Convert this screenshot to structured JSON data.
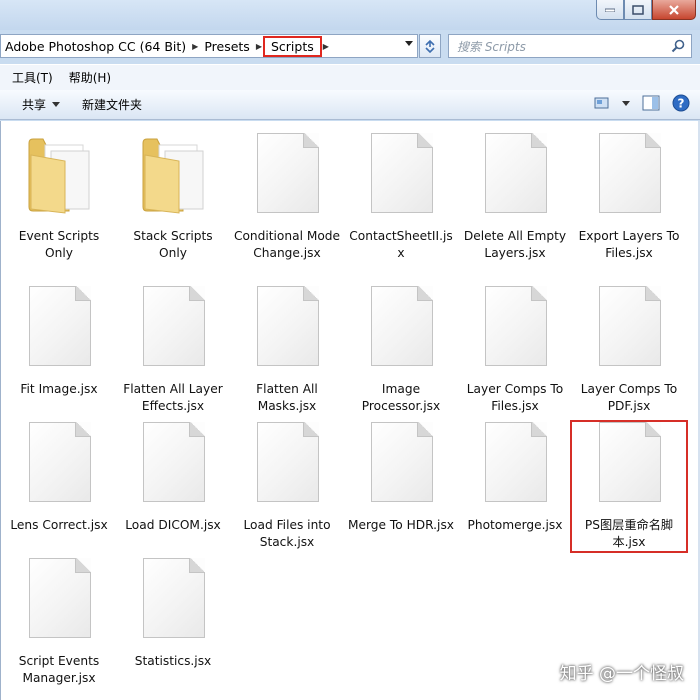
{
  "breadcrumb": [
    "Adobe Photoshop CC (64 Bit)",
    "Presets",
    "Scripts"
  ],
  "search": {
    "placeholder": "搜索 Scripts"
  },
  "menu": [
    "工具(T)",
    "帮助(H)"
  ],
  "toolbar": {
    "share_label": "共享",
    "new_folder_label": "新建文件夹"
  },
  "files": [
    {
      "name": "Event Scripts Only",
      "type": "folder"
    },
    {
      "name": "Stack Scripts Only",
      "type": "folder"
    },
    {
      "name": "Conditional Mode Change.jsx",
      "type": "file"
    },
    {
      "name": "ContactSheetII.jsx",
      "type": "file"
    },
    {
      "name": "Delete All Empty Layers.jsx",
      "type": "file"
    },
    {
      "name": "Export Layers To Files.jsx",
      "type": "file"
    },
    {
      "name": "Fit Image.jsx",
      "type": "file"
    },
    {
      "name": "Flatten All Layer Effects.jsx",
      "type": "file"
    },
    {
      "name": "Flatten All Masks.jsx",
      "type": "file"
    },
    {
      "name": "Image Processor.jsx",
      "type": "file"
    },
    {
      "name": "Layer Comps To Files.jsx",
      "type": "file"
    },
    {
      "name": "Layer Comps To PDF.jsx",
      "type": "file"
    },
    {
      "name": "Lens Correct.jsx",
      "type": "file"
    },
    {
      "name": "Load DICOM.jsx",
      "type": "file"
    },
    {
      "name": "Load Files into Stack.jsx",
      "type": "file"
    },
    {
      "name": "Merge To HDR.jsx",
      "type": "file"
    },
    {
      "name": "Photomerge.jsx",
      "type": "file"
    },
    {
      "name": "PS图层重命名脚本.jsx",
      "type": "file",
      "highlighted": true
    },
    {
      "name": "Script Events Manager.jsx",
      "type": "file"
    },
    {
      "name": "Statistics.jsx",
      "type": "file"
    }
  ],
  "watermark": "知乎 @一个怪叔",
  "colors": {
    "highlight": "#d62e27",
    "folder": "#f3d98b"
  }
}
